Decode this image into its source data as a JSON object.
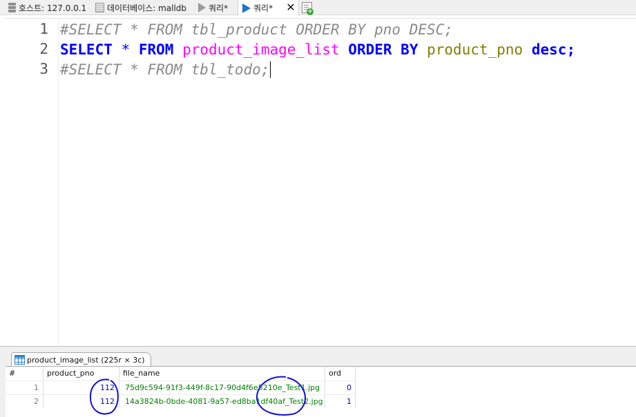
{
  "tabs": {
    "host_label": "호스트: 127.0.0.1",
    "database_label": "데이터베이스: malldb",
    "query_tab_1": "쿼리*",
    "query_tab_2": "쿼리*",
    "close_glyph": "✕"
  },
  "editor": {
    "lines": [
      {
        "number": "1",
        "text": "#SELECT * FROM tbl_product ORDER BY pno DESC;"
      },
      {
        "number": "2",
        "tokens": {
          "kw_select": "SELECT",
          "star": "*",
          "kw_from": "FROM",
          "table": "product_image_list",
          "kw_order": "ORDER",
          "kw_by": "BY",
          "column": "product_pno",
          "kw_desc": "desc",
          "semicolon": ";"
        }
      },
      {
        "number": "3",
        "text": "#SELECT * FROM tbl_todo;"
      }
    ]
  },
  "result": {
    "tab_label": "product_image_list (225r × 3c)",
    "columns": [
      "#",
      "product_pno",
      "file_name",
      "ord"
    ],
    "rows": [
      {
        "index": "1",
        "product_pno": "112",
        "file_name": "75d9c594-91f3-449f-8c17-90d4f6e5210e_Test1.jpg",
        "ord": "0"
      },
      {
        "index": "2",
        "product_pno": "112",
        "file_name": "14a3824b-0bde-4081-9a57-ed8ba1df40af_Test2.jpg",
        "ord": "1"
      }
    ]
  },
  "colors": {
    "keyword": "#0000ff",
    "comment": "#8a8a8a",
    "table_name": "#ff00ff",
    "column_name": "#808000",
    "annotation": "#1010d0"
  }
}
